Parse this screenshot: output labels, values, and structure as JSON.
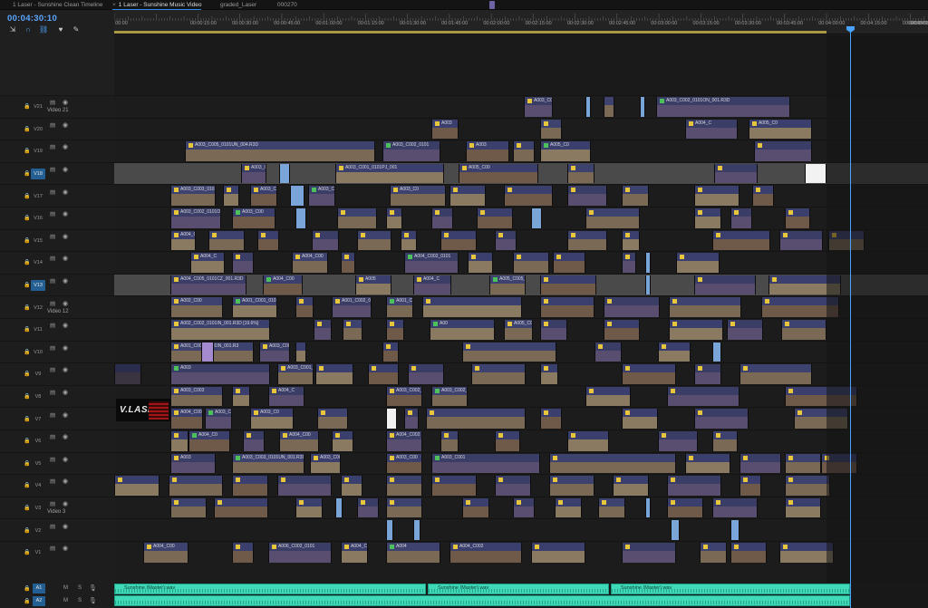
{
  "tabs": [
    {
      "label": "1 Laser - Sunshine Clean Timeline",
      "active": false,
      "closable": false
    },
    {
      "label": "1 Laser - Sunshine Music Video",
      "active": true,
      "closable": true
    },
    {
      "label": "graded_Laser",
      "active": false,
      "closable": false
    },
    {
      "label": "000270",
      "active": false,
      "closable": false
    }
  ],
  "timecode": "00:04:30:10",
  "tools": [
    {
      "name": "insert-sequence-icon",
      "glyph": "⇲"
    },
    {
      "name": "snap-magnet-icon",
      "glyph": "∩"
    },
    {
      "name": "linked-selection-icon",
      "glyph": "⛓"
    },
    {
      "name": "add-marker-icon",
      "glyph": "♥"
    },
    {
      "name": "wrench-settings-icon",
      "glyph": "🔧"
    }
  ],
  "ruler": {
    "labels": [
      "00:00",
      "00:00:15:00",
      "00:00:30:00",
      "00:00:45:00",
      "00:01:00:00",
      "00:01:15:00",
      "00:01:30:00",
      "00:01:45:00",
      "00:02:00:00",
      "00:02:15:00",
      "00:02:30:00",
      "00:02:45:00",
      "00:03:00:00",
      "00:03:15:00",
      "00:03:30:00",
      "00:03:45:00",
      "00:04:00:00",
      "00:04:15:00",
      "00:04:30:00",
      "00:04:45:00",
      "00:05:00"
    ]
  },
  "video_tracks": [
    {
      "id": "V21",
      "label": "Video 21",
      "selected": false
    },
    {
      "id": "V20",
      "label": "",
      "selected": false
    },
    {
      "id": "V19",
      "label": "",
      "selected": false
    },
    {
      "id": "V18",
      "label": "",
      "selected": true
    },
    {
      "id": "V17",
      "label": "",
      "selected": false
    },
    {
      "id": "V16",
      "label": "",
      "selected": false
    },
    {
      "id": "V15",
      "label": "",
      "selected": false
    },
    {
      "id": "V14",
      "label": "",
      "selected": false
    },
    {
      "id": "V13",
      "label": "",
      "selected": true
    },
    {
      "id": "V12",
      "label": "Video 12",
      "selected": false
    },
    {
      "id": "V11",
      "label": "",
      "selected": false
    },
    {
      "id": "V10",
      "label": "",
      "selected": false
    },
    {
      "id": "V9",
      "label": "",
      "selected": false
    },
    {
      "id": "V8",
      "label": "",
      "selected": false
    },
    {
      "id": "V7",
      "label": "",
      "selected": false
    },
    {
      "id": "V6",
      "label": "",
      "selected": false
    },
    {
      "id": "V5",
      "label": "",
      "selected": false
    },
    {
      "id": "V4",
      "label": "",
      "selected": false
    },
    {
      "id": "V3",
      "label": "Video 3",
      "selected": false
    },
    {
      "id": "V2",
      "label": "",
      "selected": false
    },
    {
      "id": "V1",
      "label": "",
      "selected": false
    }
  ],
  "audio_tracks": [
    {
      "id": "A1",
      "m": "M",
      "s": "S"
    },
    {
      "id": "A2",
      "m": "M",
      "s": "S"
    }
  ],
  "clip_names": {
    "v21": [
      "A003_C003_0101ON",
      "A003_C002_0101ON_001.R3D"
    ],
    "v20": [
      "A003",
      "A004_C",
      "A005_C0"
    ],
    "v19": [
      "A003_C005_0101UN_004.R3D",
      "A003_C002_0101",
      "A003",
      "A005_C0"
    ],
    "v18": [
      "A003_C004_0101PJ_001.R3D",
      "A003_C001_0101PJ_001",
      "A005_C00"
    ],
    "v17": [
      "A003_C003_0101",
      "A003_C00",
      "A003_C002_0101",
      "A003_C0"
    ],
    "v16": [
      "A003_C002_0101ON_001.R3D",
      "A003_C00"
    ],
    "v15": [
      "A004_C001_0101"
    ],
    "v14": [
      "A004_C",
      "A004_C00",
      "A004_C002_0101"
    ],
    "v13": [
      "A004_C005_0101CZ_001.R3D",
      "A004_C00",
      "A005",
      "A004_C",
      "A005_C005_0101CZ_001"
    ],
    "v12": [
      "A002_C00",
      "A001_C001_0101UC_001.R3D",
      "A001_C002_0101UC_001.R3D",
      "A001_C001"
    ],
    "v11": [
      "A002_C002_0101IN_001.R3D [19.6%]",
      "A00",
      "A005_C00"
    ],
    "v10": [
      "A001_C003_0101IN_001.R3",
      "A003_C003_0101IN_001.R3D [20%]"
    ],
    "v9": [
      "A003",
      "A003_C001_0101"
    ],
    "v8": [
      "A003_C003",
      "A004_C",
      "A003_C002_0101WA_001.R3D",
      "A003_C002_0101WA"
    ],
    "v7": [
      "A004_C002_0101",
      "A003_C005_0101WA_001.R3D",
      "A003_C0"
    ],
    "v6": [
      "A004_C0",
      "A004_C00",
      "A004_C002"
    ],
    "v5": [
      "A003",
      "A003_C003_0101UN_001.R3D",
      "A003_C001",
      "A003_C00",
      "A003_C001"
    ],
    "v4": [],
    "v3": [],
    "v2": [],
    "v1": [
      "A004_C00",
      "A006_C002_0101",
      "A004_C001",
      "A004",
      "A004_C002"
    ]
  },
  "audio_clip_label": "Sunshine (Master).wav",
  "logo_text": "V.LASE"
}
